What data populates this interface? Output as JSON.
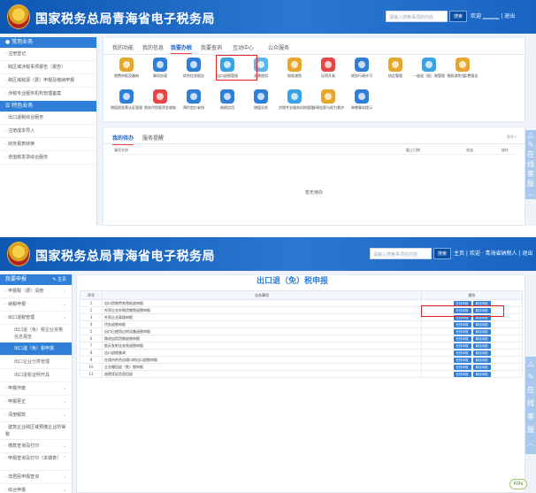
{
  "shot1": {
    "header": {
      "title": "国家税务总局青海省电子税务局",
      "search_placeholder": "请输入搜索事项的内容",
      "search_button": "搜索",
      "user_text": "欢迎 ▁▁▁▁ | 退出"
    },
    "sidebar": {
      "sections": [
        {
          "label": "● 常用业务",
          "items": [
            "· 注册登记",
            "· 跨区域涉税事项报告（报告）",
            "· 跨区域税源（费）申报及缴纳申报",
            "· 涉税专业服务机构管理备案"
          ]
        },
        {
          "label": "☰ 特色业务",
          "items": [
            "· 出口退税综合服务",
            "· 注册成本导入",
            "· 财务报表转换",
            "· 增值税发票综合服务"
          ]
        }
      ]
    },
    "tabs": [
      "我的功能",
      "我的信息",
      "我要办税",
      "我要查询",
      "互动中心",
      "公众服务"
    ],
    "active_tab": "我要办税",
    "icons": [
      {
        "label": "税费申报及缴纳",
        "icon": "declare-icon",
        "color": "#e8a62a"
      },
      {
        "label": "事项办理",
        "icon": "pen-icon",
        "color": "#2f7fd8"
      },
      {
        "label": "综合信息报告",
        "icon": "doc-icon",
        "color": "#2f7fd8"
      },
      {
        "label": "出口退税管理",
        "icon": "globe-icon",
        "color": "#3aa3e3"
      },
      {
        "label": "发票使用",
        "icon": "invoice-icon",
        "color": "#5bb6f0"
      },
      {
        "label": "税收减免",
        "icon": "coin-icon",
        "color": "#e8a62a"
      },
      {
        "label": "证明开具",
        "icon": "stamp-icon",
        "color": "#e64646"
      },
      {
        "label": "税务行政许可",
        "icon": "card-icon",
        "color": "#2f7fd8"
      },
      {
        "label": "核定管理",
        "icon": "person-icon",
        "color": "#e8a62a"
      },
      {
        "label": "一般退（抵）税管理",
        "icon": "refund-icon",
        "color": "#3aa3e3"
      },
      {
        "label": "税收减免(缓)费报告",
        "icon": "user-icon",
        "color": "#e8a62a"
      },
      {
        "label": "增值税发票认证管理",
        "icon": "check-icon",
        "color": "#2f7fd8"
      },
      {
        "label": "税务代保管资金收取",
        "icon": "money-icon",
        "color": "#e64646"
      },
      {
        "label": "预约定价安排",
        "icon": "bulb-icon",
        "color": "#2f7fd8"
      },
      {
        "label": "纳税信用",
        "icon": "shield-icon",
        "color": "#2f7fd8"
      },
      {
        "label": "增值业务",
        "icon": "grid-icon",
        "color": "#2f7fd8"
      },
      {
        "label": "涉税专业服务机构管理",
        "icon": "staff-icon",
        "color": "#3aa3e3"
      },
      {
        "label": "法律追索与权力救济",
        "icon": "gavel-icon",
        "color": "#e8a62a"
      },
      {
        "label": "神兽事务提示",
        "icon": "list-icon",
        "color": "#2f7fd8"
      }
    ],
    "highlighted_icon": "出口退税管理",
    "tasks": {
      "tabs": [
        "我的待办",
        "服务提醒"
      ],
      "more": "更多＞",
      "columns": [
        "事项名称",
        "截止日期",
        "状态",
        "操作"
      ],
      "empty": "暂无待办"
    },
    "rail": [
      "△",
      "✎",
      "在",
      "线",
      "客",
      "服",
      "︿"
    ]
  },
  "shot2": {
    "header": {
      "title": "国家税务总局青海省电子税务局",
      "search_placeholder": "请输入搜索事项的内容",
      "search_button": "搜索",
      "user_text": "主页 | 欢迎 · 青海省纳税人 | 退出"
    },
    "sidebar": {
      "head": "我要申报",
      "head_tail": "✎ 主页",
      "items": [
        {
          "label": "· 申报税（费）清册",
          "type": "group"
        },
        {
          "label": "· 纳税申报",
          "type": "group"
        },
        {
          "label": "· 出口退税管理",
          "type": "group"
        },
        {
          "label": "出口退（免）税企业资格信息报告",
          "type": "sub"
        },
        {
          "label": "出口退（免）税申报",
          "type": "sub-active"
        },
        {
          "label": "出口企业分类管理",
          "type": "sub"
        },
        {
          "label": "出口退税证明开具",
          "type": "sub"
        },
        {
          "label": "· 申报作废",
          "type": "group"
        },
        {
          "label": "· 申报更正",
          "type": "group"
        },
        {
          "label": "· 清册税款",
          "type": "group"
        },
        {
          "label": "· 建筑企业跨区域预缴企业所得税",
          "type": "group"
        },
        {
          "label": "· 缴款查询及打印",
          "type": "group"
        },
        {
          "label": "· 申报查询及打印（本期表）",
          "type": "group"
        },
        {
          "label": "· 非居民申报查询",
          "type": "group"
        },
        {
          "label": "· 综合申报",
          "type": "group"
        }
      ]
    },
    "page_title": "出口退（免）税申报",
    "table": {
      "headers": [
        "序号",
        "业务事项",
        "操作"
      ],
      "rows": [
        {
          "no": "1",
          "name": "出口货物劳务免抵退申报"
        },
        {
          "no": "2",
          "name": "外贸企业外购货物免退税申报"
        },
        {
          "no": "3",
          "name": "外贸企业离境申报"
        },
        {
          "no": "4",
          "name": "代办退税申报"
        },
        {
          "no": "5",
          "name": "出口已使用过的设备退税申报"
        },
        {
          "no": "6",
          "name": "购进自用货物退税申报"
        },
        {
          "no": "7",
          "name": "航天发射业务免退税申报"
        },
        {
          "no": "8",
          "name": "出口退税查询"
        },
        {
          "no": "9",
          "name": "在境内符合出境口的出口退税申报"
        },
        {
          "no": "10",
          "name": "企业撤回退（免）税申报"
        },
        {
          "no": "11",
          "name": "退税凭证信息回退"
        }
      ],
      "btn_online": "在线申报",
      "btn_offline": "离线申报"
    },
    "rail": [
      "△",
      "✎",
      "在",
      "线",
      "客",
      "服",
      "︿"
    ],
    "badge": "69s"
  }
}
